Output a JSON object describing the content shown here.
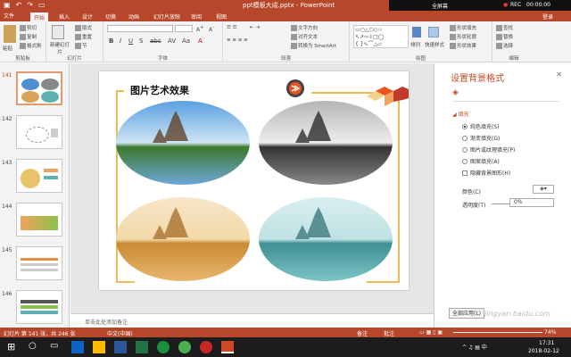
{
  "title": "ppt模板大成.pptx - PowerPoint",
  "recorder": {
    "label": "全屏幕",
    "rec": "REC",
    "time": "00:00:00"
  },
  "tabs": [
    "文件",
    "开始",
    "插入",
    "设计",
    "切换",
    "动画",
    "幻灯片放映",
    "审阅",
    "视图"
  ],
  "active_tab": "开始",
  "login": "登录",
  "ribbon": {
    "clipboard": {
      "label": "剪贴板",
      "paste": "粘贴",
      "cut": "剪切",
      "copy": "复制",
      "format": "格式刷"
    },
    "slides": {
      "label": "幻灯片",
      "new": "新建幻灯片",
      "layout": "版式",
      "reset": "重置",
      "section": "节"
    },
    "font": {
      "label": "字体"
    },
    "paragraph": {
      "label": "段落",
      "direction": "文字方向",
      "align": "对齐文本",
      "smartart": "转换为 SmartArt"
    },
    "drawing": {
      "label": "绘图",
      "arrange": "排列",
      "styles": "快速样式",
      "fill": "形状填充",
      "outline": "形状轮廓",
      "effect": "形状效果"
    },
    "editing": {
      "label": "编辑",
      "find": "查找",
      "replace": "替换",
      "select": "选择"
    }
  },
  "thumbnails": [
    {
      "num": "141",
      "selected": true
    },
    {
      "num": "142",
      "selected": false
    },
    {
      "num": "143",
      "selected": false
    },
    {
      "num": "144",
      "selected": false
    },
    {
      "num": "145",
      "selected": false
    },
    {
      "num": "146",
      "selected": false
    }
  ],
  "slide": {
    "title": "图片艺术效果"
  },
  "notes": "单击此处添加备注",
  "format_pane": {
    "title": "设置背景格式",
    "section": "填充",
    "options": [
      "纯色填充(S)",
      "渐变填充(G)",
      "图片或纹理填充(P)",
      "图案填充(A)"
    ],
    "selected_option": 0,
    "hide_bg": "隐藏背景图形(H)",
    "color_label": "颜色(C)",
    "transparency_label": "透明度(T)",
    "transparency_value": "0%",
    "apply_all": "全部应用(L)"
  },
  "status": {
    "slide": "幻灯片 第 141 张，共 246 张",
    "lang": "中文(中国)",
    "notes": "备注",
    "comments": "批注",
    "zoom": "74%"
  },
  "taskbar": {
    "time": "17:31",
    "date": "2018-02-12"
  },
  "watermark": "jingyan.baidu.com",
  "colors": {
    "accent": "#b7472a",
    "ellipse1": "#4f8fd1",
    "ellipse2": "#888888",
    "ellipse3": "#d9a35a",
    "ellipse4": "#5fb0b3"
  }
}
